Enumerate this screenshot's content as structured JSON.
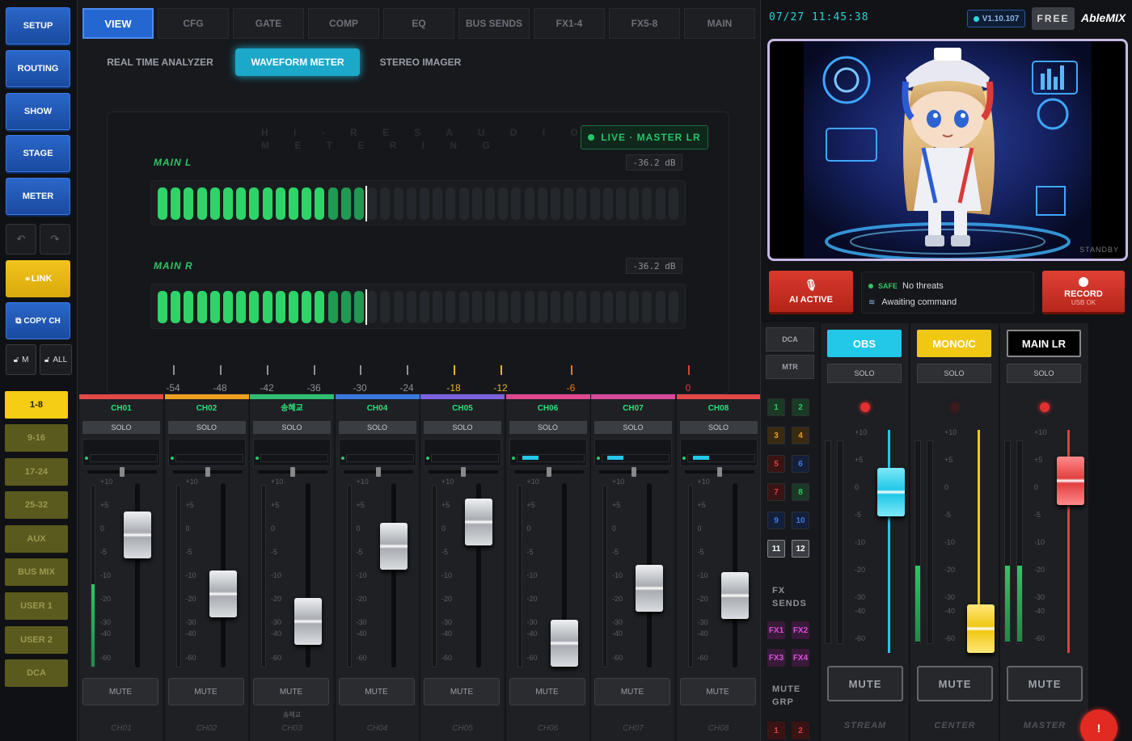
{
  "left_nav": {
    "buttons": [
      "SETUP",
      "ROUTING",
      "SHOW",
      "STAGE",
      "METER"
    ],
    "link": "LINK",
    "copy_ch": "COPY CH",
    "lock_m": "M",
    "lock_all": "ALL",
    "banks": [
      "1-8",
      "9-16",
      "17-24",
      "25-32",
      "AUX",
      "BUS MIX",
      "USER 1",
      "USER 2",
      "DCA"
    ]
  },
  "tabs": [
    "VIEW",
    "CFG",
    "GATE",
    "COMP",
    "EQ",
    "BUS SENDS",
    "FX1-4",
    "FX5-8",
    "MAIN"
  ],
  "subtabs": [
    "REAL TIME ANALYZER",
    "WAVEFORM METER",
    "STEREO IMAGER"
  ],
  "meter": {
    "ghost_line1": "H I - R E S   A U D I O",
    "ghost_line2": "M E T E R I N G",
    "live_label": "LIVE · MASTER LR",
    "left_label": "MAIN L",
    "right_label": "MAIN R",
    "left_db": "-36.2 dB",
    "right_db": "-36.2 dB",
    "left_level": 0.39,
    "right_level": 0.39,
    "scale": [
      "-54",
      "-48",
      "-42",
      "-36",
      "-30",
      "-24",
      "-18",
      "-12",
      "-6",
      "0"
    ]
  },
  "channels": [
    {
      "name": "CH01",
      "foot": "CH01",
      "color": "#e24848",
      "fader": 0.72
    },
    {
      "name": "CH02",
      "foot": "CH02",
      "color": "#f0a020",
      "fader": 0.4
    },
    {
      "name": "송혜교",
      "foot": "CH03",
      "sub": "송혜교",
      "color": "#2ec070",
      "fader": 0.25
    },
    {
      "name": "CH04",
      "foot": "CH04",
      "color": "#3a78e0",
      "fader": 0.66
    },
    {
      "name": "CH05",
      "foot": "CH05",
      "color": "#7b62e0",
      "fader": 0.79
    },
    {
      "name": "CH06",
      "foot": "CH06",
      "color": "#e04890",
      "fader": 0.13
    },
    {
      "name": "CH07",
      "foot": "CH07",
      "color": "#d84a9c",
      "fader": 0.43
    },
    {
      "name": "CH08",
      "foot": "CH08",
      "color": "#e24848",
      "fader": 0.39
    }
  ],
  "strip_labels": {
    "solo": "SOLO",
    "mute": "MUTE",
    "scale": [
      "+10",
      "+5",
      "0",
      "-5",
      "-10",
      "-20",
      "-30",
      "-40",
      "-60"
    ]
  },
  "header_right": {
    "clock": "07/27 11:45:38",
    "version": "V1.10.107",
    "free": "FREE",
    "brand": "AbleMIX",
    "standby": "STANDBY"
  },
  "controls": {
    "ai_active": "AI ACTIVE",
    "safe": "SAFE",
    "no_threats": "No threats",
    "awaiting": "Awaiting command",
    "record": "RECORD",
    "usb_ok": "USB OK"
  },
  "side_select": {
    "dca": "DCA",
    "mtr": "MTR",
    "groups": [
      "1",
      "2",
      "3",
      "4",
      "5",
      "6",
      "7",
      "8",
      "9",
      "10",
      "11",
      "12"
    ],
    "fx_sends_1": "FX",
    "fx_sends_2": "SENDS",
    "fx": [
      "FX1",
      "FX2",
      "FX3",
      "FX4"
    ],
    "mute_grp_1": "MUTE",
    "mute_grp_2": "GRP",
    "mute_grp": [
      "1",
      "2"
    ]
  },
  "masters": [
    {
      "name": "OBS",
      "foot": "STREAM",
      "bg": "#22c8e8",
      "fg": "#ffffff",
      "fader": 0.72,
      "led": "#e03030"
    },
    {
      "name": "MONO/C",
      "foot": "CENTER",
      "bg": "#f0c814",
      "fg": "#ffffff",
      "fader": 0.11,
      "led": "#3a1a1a"
    },
    {
      "name": "MAIN LR",
      "foot": "MASTER",
      "bg": "#000000",
      "fg": "#ffffff",
      "fader": 0.77,
      "led": "#e03030"
    }
  ],
  "alert": "!"
}
